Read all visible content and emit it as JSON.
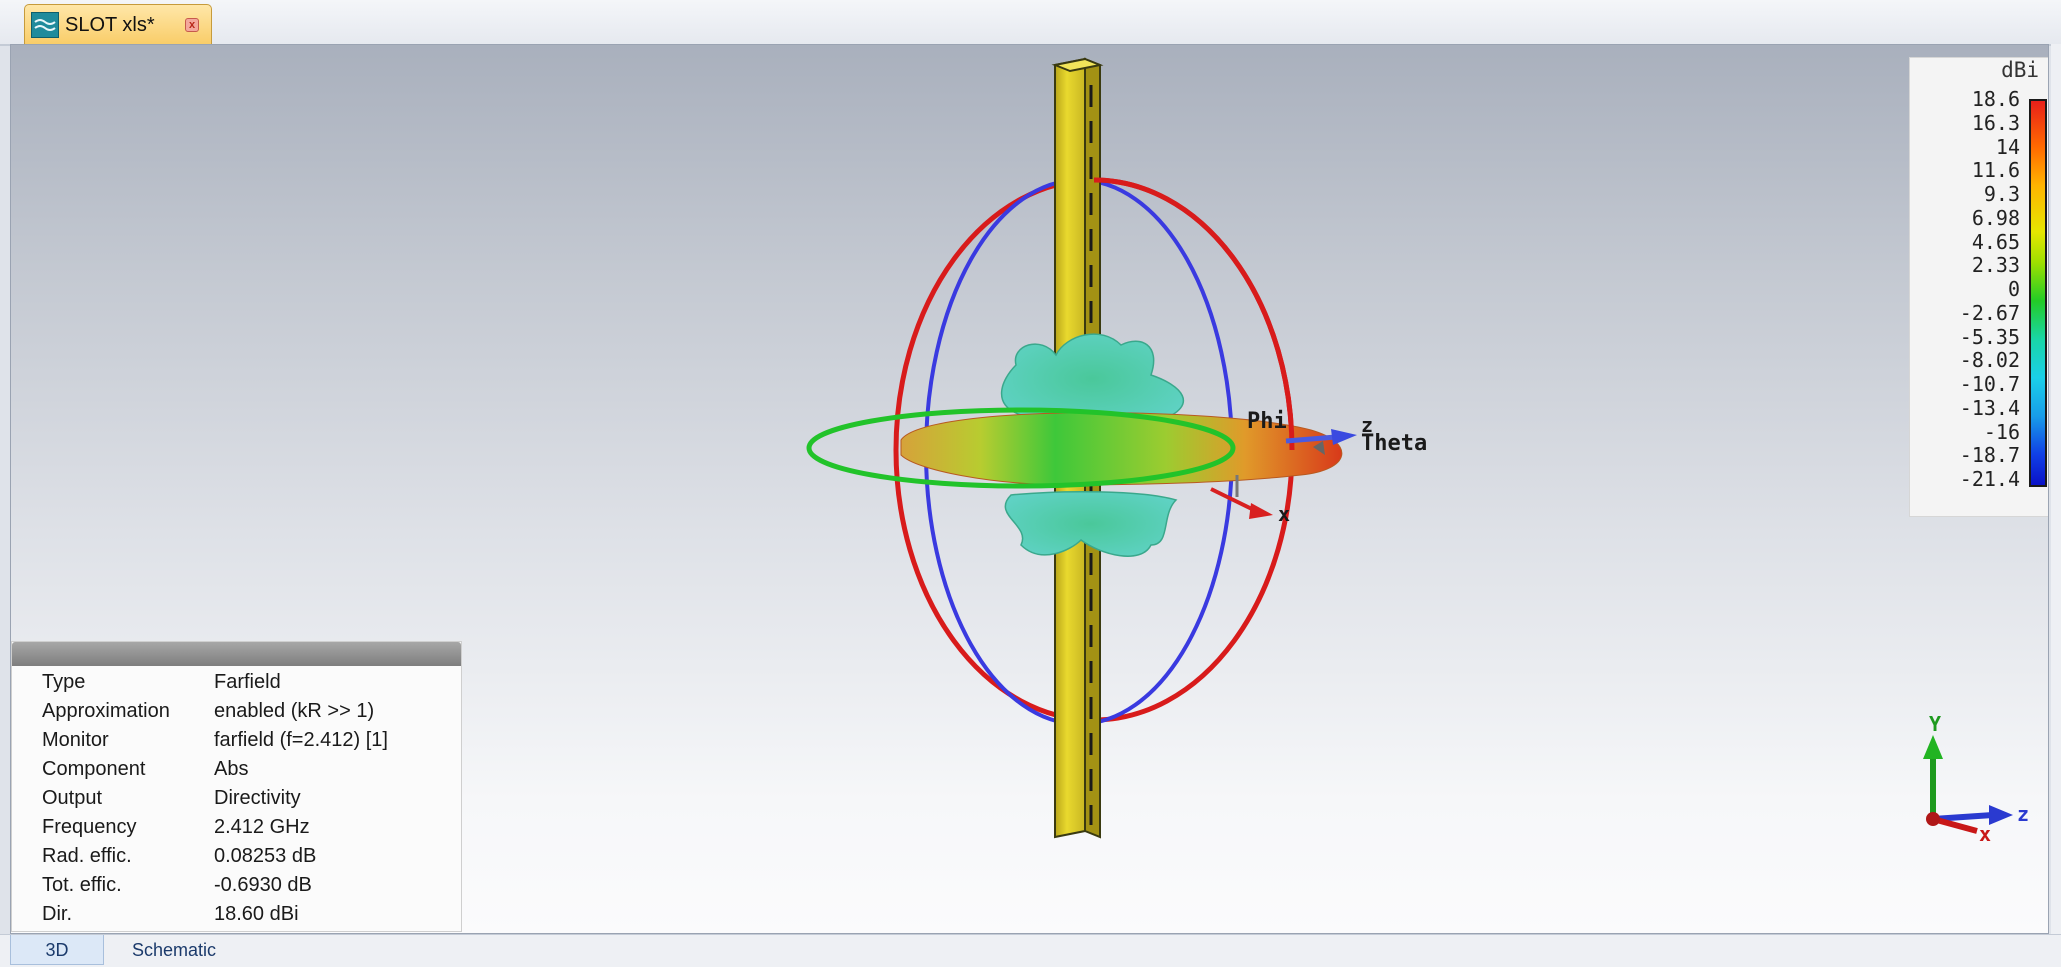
{
  "document_tab": {
    "title": "SLOT xls*"
  },
  "scene": {
    "labels": {
      "phi": "Phi",
      "theta": "Theta",
      "z": "z",
      "x": "x"
    }
  },
  "triad": {
    "y": "Y",
    "z": "z",
    "x": "x"
  },
  "colorbar": {
    "unit": "dBi",
    "ticks": [
      "18.6",
      "16.3",
      "14",
      "11.6",
      "9.3",
      "6.98",
      "4.65",
      "2.33",
      "0",
      "-2.67",
      "-5.35",
      "-8.02",
      "-10.7",
      "-13.4",
      "-16",
      "-18.7",
      "-21.4"
    ]
  },
  "info": {
    "rows": [
      {
        "key": "Type",
        "value": "Farfield"
      },
      {
        "key": "Approximation",
        "value": "enabled (kR >> 1)"
      },
      {
        "key": "Monitor",
        "value": "farfield (f=2.412) [1]"
      },
      {
        "key": "Component",
        "value": "Abs"
      },
      {
        "key": "Output",
        "value": "Directivity"
      },
      {
        "key": "Frequency",
        "value": "2.412 GHz"
      },
      {
        "key": "Rad. effic.",
        "value": "0.08253 dB"
      },
      {
        "key": "Tot. effic.",
        "value": "-0.6930 dB"
      },
      {
        "key": "Dir.",
        "value": "18.60 dBi"
      }
    ]
  },
  "bottom_tabs": {
    "tab_3d": "3D",
    "tab_schematic": "Schematic"
  }
}
